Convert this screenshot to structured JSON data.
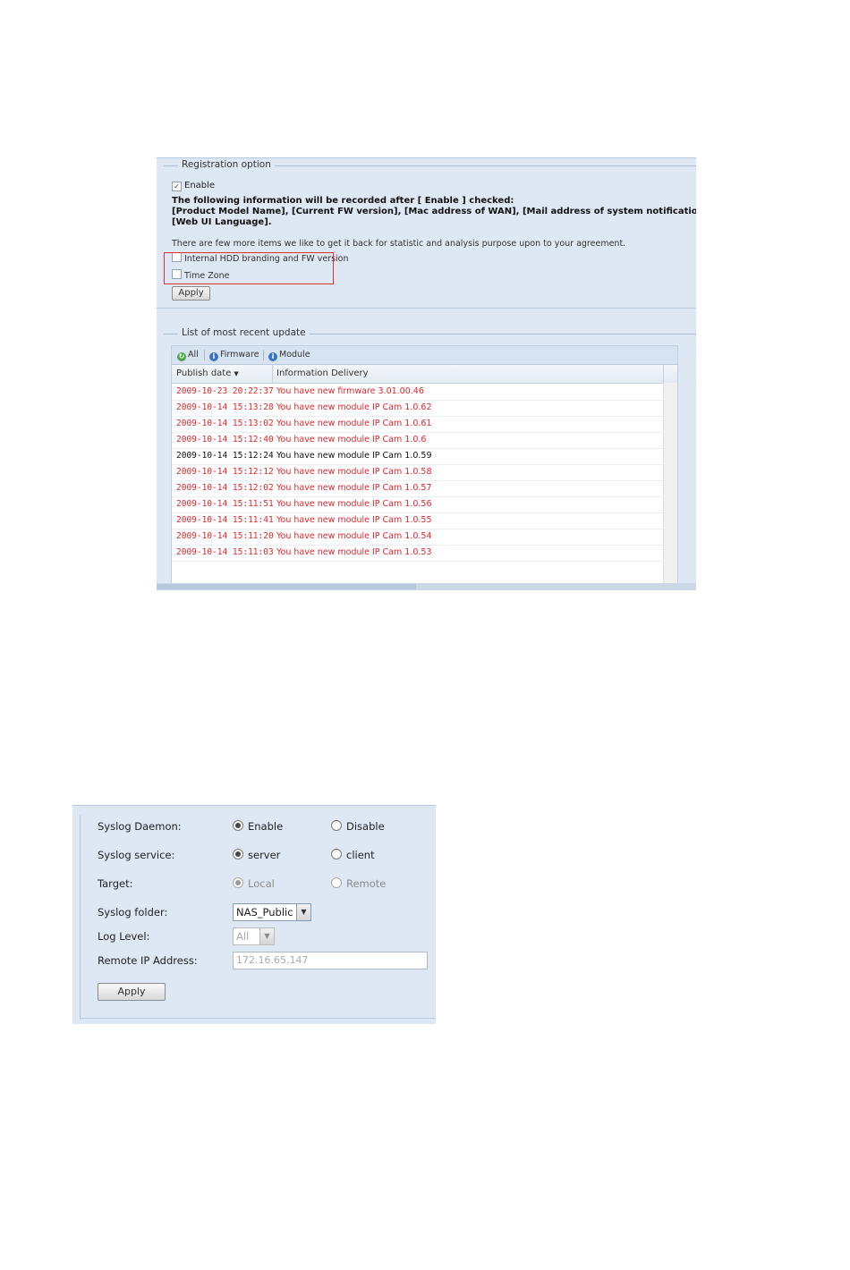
{
  "registration": {
    "legend": "Registration option",
    "enable_label": "Enable",
    "enable_checked": true,
    "info_line1": "The following information will be recorded after [ Enable ] checked:",
    "info_line2": "[Product Model Name], [Current FW version], [Mac address of WAN], [Mail address of system notification],",
    "info_line3": "[Web UI Language].",
    "extra_note": "There are few more items we like to get it back for statistic and analysis purpose upon to your agreement.",
    "hdd_label": "Internal HDD branding and FW version",
    "timezone_label": "Time Zone",
    "apply_label": "Apply"
  },
  "update_list": {
    "legend": "List of most recent update",
    "toolbar": {
      "all_label": "All",
      "firmware_label": "Firmware",
      "module_label": "Module"
    },
    "columns": {
      "publish_date": "Publish date",
      "info": "Information Delivery"
    },
    "rows": [
      {
        "date": "2009-10-23 20:22:37",
        "info": "You have new firmware 3.01.00.46",
        "color": "#e0262b"
      },
      {
        "date": "2009-10-14 15:13:28",
        "info": "You have new module IP Cam 1.0.62",
        "color": "#e0262b"
      },
      {
        "date": "2009-10-14 15:13:02",
        "info": "You have new module IP Cam 1.0.61",
        "color": "#e0262b"
      },
      {
        "date": "2009-10-14 15:12:40",
        "info": "You have new module IP Cam 1.0.6",
        "color": "#e0262b"
      },
      {
        "date": "2009-10-14 15:12:24",
        "info": "You have new module IP Cam 1.0.59",
        "color": "#111111"
      },
      {
        "date": "2009-10-14 15:12:12",
        "info": "You have new module IP Cam 1.0.58",
        "color": "#e0262b"
      },
      {
        "date": "2009-10-14 15:12:02",
        "info": "You have new module IP Cam 1.0.57",
        "color": "#e0262b"
      },
      {
        "date": "2009-10-14 15:11:51",
        "info": "You have new module IP Cam 1.0.56",
        "color": "#e0262b"
      },
      {
        "date": "2009-10-14 15:11:41",
        "info": "You have new module IP Cam 1.0.55",
        "color": "#e0262b"
      },
      {
        "date": "2009-10-14 15:11:20",
        "info": "You have new module IP Cam 1.0.54",
        "color": "#e0262b"
      },
      {
        "date": "2009-10-14 15:11:03",
        "info": "You have new module IP Cam 1.0.53",
        "color": "#e0262b"
      }
    ]
  },
  "syslog": {
    "daemon_label": "Syslog Daemon:",
    "daemon_enable": "Enable",
    "daemon_disable": "Disable",
    "service_label": "Syslog service:",
    "service_server": "server",
    "service_client": "client",
    "target_label": "Target:",
    "target_local": "Local",
    "target_remote": "Remote",
    "folder_label": "Syslog folder:",
    "folder_value": "NAS_Public",
    "log_level_label": "Log Level:",
    "log_level_value": "All",
    "remote_ip_label": "Remote IP Address:",
    "remote_ip_value": "172.16.65.147",
    "apply_label": "Apply"
  }
}
